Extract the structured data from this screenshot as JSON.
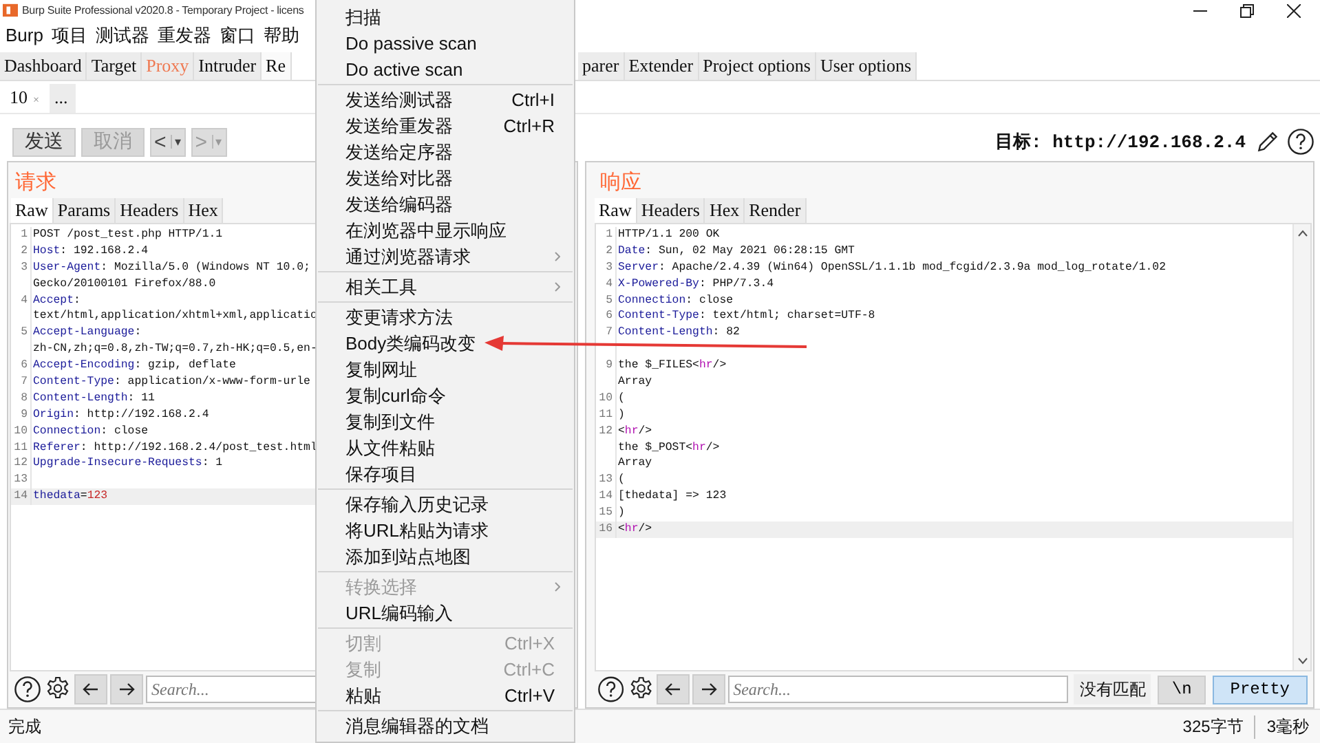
{
  "window": {
    "title": "Burp Suite Professional v2020.8 - Temporary Project - licens"
  },
  "menu_bar": [
    "Burp",
    "项目",
    "测试器",
    "重发器",
    "窗口",
    "帮助"
  ],
  "main_tabs": [
    {
      "label": "Dashboard",
      "selected": false,
      "alert": false
    },
    {
      "label": "Target",
      "selected": false,
      "alert": false
    },
    {
      "label": "Proxy",
      "selected": false,
      "alert": true
    },
    {
      "label": "Intruder",
      "selected": false,
      "alert": false
    },
    {
      "label": "Re",
      "selected": true,
      "alert": false
    }
  ],
  "more_main_tabs": [
    {
      "label": "parer",
      "selected": false,
      "alert": false
    },
    {
      "label": "Extender",
      "selected": false,
      "alert": false
    },
    {
      "label": "Project options",
      "selected": false,
      "alert": false
    },
    {
      "label": "User options",
      "selected": false,
      "alert": false
    }
  ],
  "sub_tabs": [
    {
      "label": "10",
      "close": "×",
      "selected": true
    },
    {
      "label": "...",
      "selected": false
    }
  ],
  "toolbar": {
    "buttons": [
      {
        "label": "发送",
        "disabled": false
      },
      {
        "label": "取消",
        "disabled": true
      }
    ],
    "nav": [
      {
        "label": "<",
        "dropdown": "▾",
        "disabled": false
      },
      {
        "label": ">",
        "dropdown": "▾",
        "disabled": true
      }
    ],
    "target": "目标: http://192.168.2.4"
  },
  "panes": [
    {
      "title": "请求",
      "tabs": [
        {
          "label": "Raw",
          "selected": true
        },
        {
          "label": "Params",
          "selected": false
        },
        {
          "label": "Headers",
          "selected": false
        },
        {
          "label": "Hex",
          "selected": false
        }
      ],
      "rows": [
        {
          "number": "1",
          "current": false,
          "parts": [
            {
              "text": "POST /post_test.php HTTP/1.1",
              "kind": "plain"
            }
          ]
        },
        {
          "number": "2",
          "current": false,
          "parts": [
            {
              "text": "Host",
              "kind": "name"
            },
            {
              "text": ": 192.168.2.4",
              "kind": "plain"
            }
          ]
        },
        {
          "number": "3",
          "current": false,
          "parts": [
            {
              "text": "User-Agent",
              "kind": "name"
            },
            {
              "text": ": Mozilla/5.0 (Windows NT 10.0;",
              "kind": "plain"
            }
          ]
        },
        {
          "current": false,
          "parts": [
            {
              "text": "Gecko/20100101 Firefox/88.0",
              "kind": "plain"
            }
          ]
        },
        {
          "number": "4",
          "current": false,
          "parts": [
            {
              "text": "Accept",
              "kind": "name"
            },
            {
              "text": ":",
              "kind": "plain"
            }
          ]
        },
        {
          "current": false,
          "parts": [
            {
              "text": "text/html,application/xhtml+xml,applicatio",
              "kind": "plain"
            }
          ]
        },
        {
          "number": "5",
          "current": false,
          "parts": [
            {
              "text": "Accept-Language",
              "kind": "name"
            },
            {
              "text": ":",
              "kind": "plain"
            }
          ]
        },
        {
          "current": false,
          "parts": [
            {
              "text": "zh-CN,zh;q=0.8,zh-TW;q=0.7,zh-HK;q=0.5,en-",
              "kind": "plain"
            }
          ]
        },
        {
          "number": "6",
          "current": false,
          "parts": [
            {
              "text": "Accept-Encoding",
              "kind": "name"
            },
            {
              "text": ": gzip, deflate",
              "kind": "plain"
            }
          ]
        },
        {
          "number": "7",
          "current": false,
          "parts": [
            {
              "text": "Content-Type",
              "kind": "name"
            },
            {
              "text": ": application/x-www-form-urle",
              "kind": "plain"
            }
          ]
        },
        {
          "number": "8",
          "current": false,
          "parts": [
            {
              "text": "Content-Length",
              "kind": "name"
            },
            {
              "text": ": 11",
              "kind": "plain"
            }
          ]
        },
        {
          "number": "9",
          "current": false,
          "parts": [
            {
              "text": "Origin",
              "kind": "name"
            },
            {
              "text": ": http://192.168.2.4",
              "kind": "plain"
            }
          ]
        },
        {
          "number": "10",
          "current": false,
          "parts": [
            {
              "text": "Connection",
              "kind": "name"
            },
            {
              "text": ": close",
              "kind": "plain"
            }
          ]
        },
        {
          "number": "11",
          "current": false,
          "parts": [
            {
              "text": "Referer",
              "kind": "name"
            },
            {
              "text": ": http://192.168.2.4/post_test.html",
              "kind": "plain"
            }
          ]
        },
        {
          "number": "12",
          "current": false,
          "parts": [
            {
              "text": "Upgrade-Insecure-Requests",
              "kind": "name"
            },
            {
              "text": ": 1",
              "kind": "plain"
            }
          ]
        },
        {
          "number": "13",
          "current": false,
          "parts": []
        },
        {
          "number": "14",
          "current": true,
          "parts": [
            {
              "text": "thedata",
              "kind": "name"
            },
            {
              "text": "=",
              "kind": "plain"
            },
            {
              "text": "123",
              "kind": "value"
            }
          ]
        }
      ],
      "search_placeholder": "Search..."
    },
    {
      "title": "响应",
      "tabs": [
        {
          "label": "Raw",
          "selected": true
        },
        {
          "label": "Headers",
          "selected": false
        },
        {
          "label": "Hex",
          "selected": false
        },
        {
          "label": "Render",
          "selected": false
        }
      ],
      "rows": [
        {
          "number": "1",
          "current": false,
          "parts": [
            {
              "text": "HTTP/1.1 200 OK",
              "kind": "plain"
            }
          ]
        },
        {
          "number": "2",
          "current": false,
          "parts": [
            {
              "text": "Date",
              "kind": "name"
            },
            {
              "text": ": Sun, 02 May 2021 06:28:15 GMT",
              "kind": "plain"
            }
          ]
        },
        {
          "number": "3",
          "current": false,
          "parts": [
            {
              "text": "Server",
              "kind": "name"
            },
            {
              "text": ": Apache/2.4.39 (Win64) OpenSSL/1.1.1b mod_fcgid/2.3.9a mod_log_rotate/1.02",
              "kind": "plain"
            }
          ]
        },
        {
          "number": "4",
          "current": false,
          "parts": [
            {
              "text": "X-Powered-By",
              "kind": "name"
            },
            {
              "text": ": PHP/7.3.4",
              "kind": "plain"
            }
          ]
        },
        {
          "number": "5",
          "current": false,
          "parts": [
            {
              "text": "Connection",
              "kind": "name"
            },
            {
              "text": ": close",
              "kind": "plain"
            }
          ]
        },
        {
          "number": "6",
          "current": false,
          "parts": [
            {
              "text": "Content-Type",
              "kind": "name"
            },
            {
              "text": ": text/html; charset=UTF-8",
              "kind": "plain"
            }
          ]
        },
        {
          "number": "7",
          "current": false,
          "parts": [
            {
              "text": "Content-Length",
              "kind": "name"
            },
            {
              "text": ": 82",
              "kind": "plain"
            }
          ]
        },
        {
          "current": false,
          "parts": []
        },
        {
          "number": "9",
          "current": false,
          "parts": [
            {
              "text": "the $_FILES<",
              "kind": "plain"
            },
            {
              "text": "hr",
              "kind": "tag"
            },
            {
              "text": "/>",
              "kind": "plain"
            }
          ]
        },
        {
          "current": false,
          "parts": [
            {
              "text": "Array",
              "kind": "plain"
            }
          ]
        },
        {
          "number": "10",
          "current": false,
          "parts": [
            {
              "text": "(",
              "kind": "plain"
            }
          ]
        },
        {
          "number": "11",
          "current": false,
          "parts": [
            {
              "text": ")",
              "kind": "plain"
            }
          ]
        },
        {
          "number": "12",
          "current": false,
          "parts": [
            {
              "text": "<",
              "kind": "plain"
            },
            {
              "text": "hr",
              "kind": "tag"
            },
            {
              "text": "/>",
              "kind": "plain"
            }
          ]
        },
        {
          "current": false,
          "parts": [
            {
              "text": "the $_POST<",
              "kind": "plain"
            },
            {
              "text": "hr",
              "kind": "tag"
            },
            {
              "text": "/>",
              "kind": "plain"
            }
          ]
        },
        {
          "current": false,
          "parts": [
            {
              "text": "Array",
              "kind": "plain"
            }
          ]
        },
        {
          "number": "13",
          "current": false,
          "parts": [
            {
              "text": "(",
              "kind": "plain"
            }
          ]
        },
        {
          "number": "14",
          "current": false,
          "parts": [
            {
              "text": "[thedata] => 123",
              "kind": "plain"
            }
          ]
        },
        {
          "number": "15",
          "current": false,
          "parts": [
            {
              "text": ")",
              "kind": "plain"
            }
          ]
        },
        {
          "number": "16",
          "current": true,
          "parts": [
            {
              "text": "<",
              "kind": "plain"
            },
            {
              "text": "hr",
              "kind": "tag"
            },
            {
              "text": "/>",
              "kind": "plain"
            }
          ]
        }
      ],
      "search_placeholder": "Search...",
      "match_status": "没有匹配",
      "buttons": [
        {
          "label": "\\n",
          "selected": false
        },
        {
          "label": "Pretty",
          "selected": true
        }
      ]
    }
  ],
  "status_bar": {
    "text": "完成",
    "size": "325字节",
    "time": "3毫秒"
  },
  "context_menu": [
    {
      "kind": "item",
      "label": "扫描",
      "disabled": false,
      "submenu": false
    },
    {
      "kind": "item",
      "label": "Do passive scan",
      "disabled": false,
      "submenu": false
    },
    {
      "kind": "item",
      "label": "Do active scan",
      "disabled": false,
      "submenu": false
    },
    {
      "kind": "separator"
    },
    {
      "kind": "item",
      "label": "发送给测试器",
      "shortcut": "Ctrl+I",
      "disabled": false,
      "submenu": false
    },
    {
      "kind": "item",
      "label": "发送给重发器",
      "shortcut": "Ctrl+R",
      "disabled": false,
      "submenu": false
    },
    {
      "kind": "item",
      "label": "发送给定序器",
      "disabled": false,
      "submenu": false
    },
    {
      "kind": "item",
      "label": "发送给对比器",
      "disabled": false,
      "submenu": false
    },
    {
      "kind": "item",
      "label": "发送给编码器",
      "disabled": false,
      "submenu": false
    },
    {
      "kind": "item",
      "label": "在浏览器中显示响应",
      "disabled": false,
      "submenu": false
    },
    {
      "kind": "item",
      "label": "通过浏览器请求",
      "disabled": false,
      "submenu": true
    },
    {
      "kind": "separator"
    },
    {
      "kind": "item",
      "label": "相关工具",
      "disabled": false,
      "submenu": true
    },
    {
      "kind": "separator"
    },
    {
      "kind": "item",
      "label": "变更请求方法",
      "disabled": false,
      "submenu": false
    },
    {
      "kind": "item",
      "label": "Body类编码改变",
      "disabled": false,
      "submenu": false
    },
    {
      "kind": "item",
      "label": "复制网址",
      "disabled": false,
      "submenu": false
    },
    {
      "kind": "item",
      "label": "复制curl命令",
      "disabled": false,
      "submenu": false
    },
    {
      "kind": "item",
      "label": "复制到文件",
      "disabled": false,
      "submenu": false
    },
    {
      "kind": "item",
      "label": "从文件粘贴",
      "disabled": false,
      "submenu": false
    },
    {
      "kind": "item",
      "label": "保存项目",
      "disabled": false,
      "submenu": false
    },
    {
      "kind": "separator"
    },
    {
      "kind": "item",
      "label": "保存输入历史记录",
      "disabled": false,
      "submenu": false
    },
    {
      "kind": "item",
      "label": "将URL粘贴为请求",
      "disabled": false,
      "submenu": false
    },
    {
      "kind": "item",
      "label": "添加到站点地图",
      "disabled": false,
      "submenu": false
    },
    {
      "kind": "separator"
    },
    {
      "kind": "item",
      "label": "转换选择",
      "disabled": true,
      "submenu": true
    },
    {
      "kind": "item",
      "label": "URL编码输入",
      "disabled": false,
      "submenu": false
    },
    {
      "kind": "separator"
    },
    {
      "kind": "item",
      "label": "切割",
      "shortcut": "Ctrl+X",
      "disabled": true,
      "submenu": false
    },
    {
      "kind": "item",
      "label": "复制",
      "shortcut": "Ctrl+C",
      "disabled": true,
      "submenu": false
    },
    {
      "kind": "item",
      "label": "粘贴",
      "shortcut": "Ctrl+V",
      "disabled": false,
      "submenu": false
    },
    {
      "kind": "separator"
    },
    {
      "kind": "item",
      "label": "消息编辑器的文档",
      "disabled": false,
      "submenu": false
    }
  ]
}
